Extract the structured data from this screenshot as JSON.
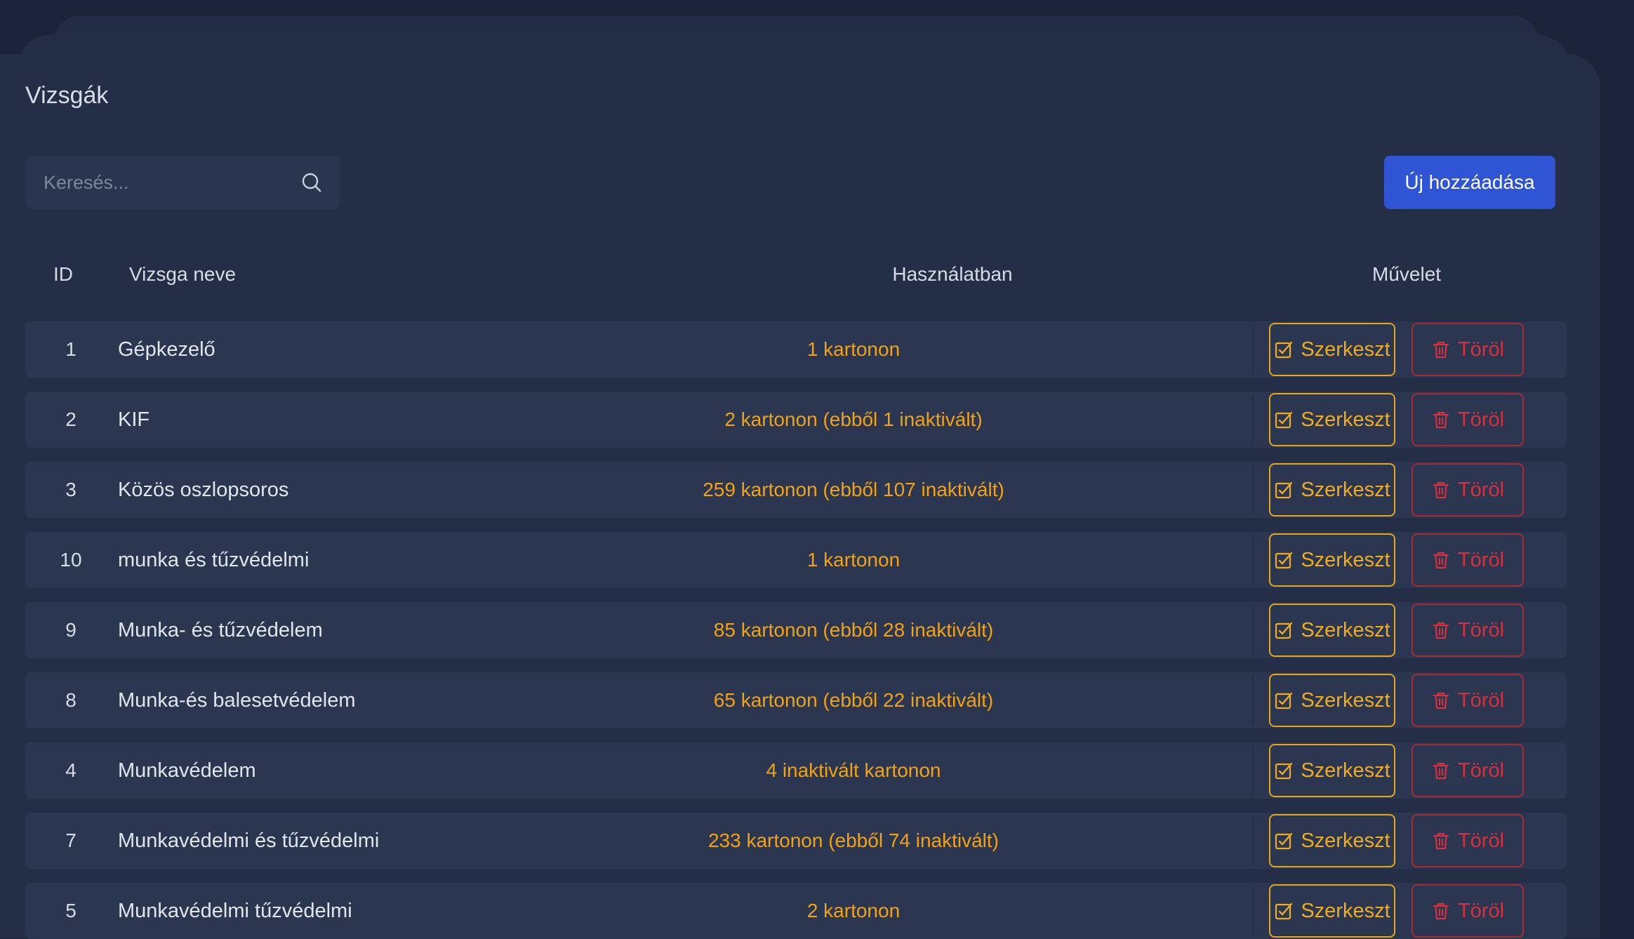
{
  "page": {
    "title": "Vizsgák"
  },
  "search": {
    "placeholder": "Keresés..."
  },
  "toolbar": {
    "add_label": "Új hozzáadása"
  },
  "table": {
    "headers": {
      "id": "ID",
      "name": "Vizsga neve",
      "usage": "Használatban",
      "action": "Művelet"
    },
    "edit_label": "Szerkeszt",
    "delete_label": "Töröl",
    "rows": [
      {
        "id": "1",
        "name": "Gépkezelő",
        "usage": "1 kartonon"
      },
      {
        "id": "2",
        "name": "KIF",
        "usage": "2 kartonon (ebből 1 inaktivált)"
      },
      {
        "id": "3",
        "name": "Közös oszlopsoros",
        "usage": "259 kartonon (ebből 107 inaktivált)"
      },
      {
        "id": "10",
        "name": "munka és tűzvédelmi",
        "usage": "1 kartonon"
      },
      {
        "id": "9",
        "name": "Munka- és tűzvédelem",
        "usage": "85 kartonon (ebből 28 inaktivált)"
      },
      {
        "id": "8",
        "name": "Munka-és balesetvédelem",
        "usage": "65 kartonon (ebből 22 inaktivált)"
      },
      {
        "id": "4",
        "name": "Munkavédelem",
        "usage": "4 inaktivált kartonon"
      },
      {
        "id": "7",
        "name": "Munkavédelmi és tűzvédelmi",
        "usage": "233 kartonon (ebből 74 inaktivált)"
      },
      {
        "id": "5",
        "name": "Munkavédelmi tűzvédelmi",
        "usage": "2 kartonon"
      }
    ]
  },
  "colors": {
    "background": "#1b2438",
    "card": "#242e47",
    "row": "#2b3651",
    "accent_blue": "#2f55d4",
    "warning_orange": "#f3a212",
    "danger_red": "#d8303d"
  },
  "icons": {
    "search": "search-icon",
    "edit": "check-square-icon",
    "delete": "trash-icon"
  }
}
